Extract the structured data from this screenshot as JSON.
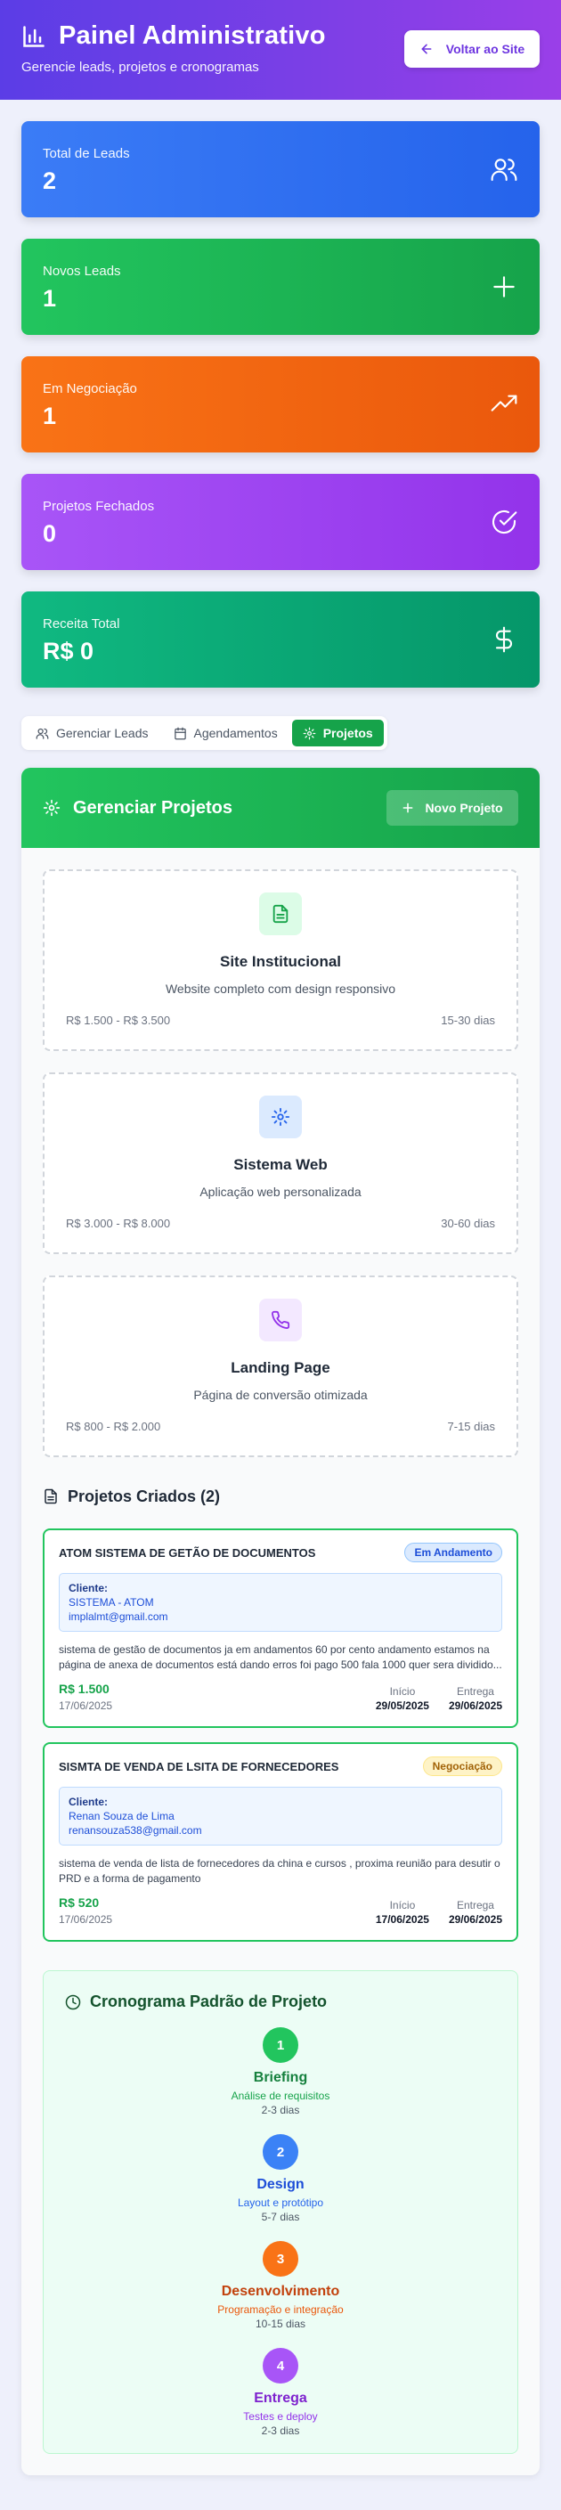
{
  "header": {
    "title": "Painel Administrativo",
    "subtitle": "Gerencie leads, projetos e cronogramas",
    "back_label": "Voltar ao Site"
  },
  "stats": [
    {
      "label": "Total de Leads",
      "value": "2",
      "icon": "users-icon",
      "color": "#2563eb"
    },
    {
      "label": "Novos Leads",
      "value": "1",
      "icon": "plus-icon",
      "color": "#16a34a"
    },
    {
      "label": "Em Negociação",
      "value": "1",
      "icon": "trending-up-icon",
      "color": "#ea580c"
    },
    {
      "label": "Projetos Fechados",
      "value": "0",
      "icon": "check-circle-icon",
      "color": "#9333ea"
    },
    {
      "label": "Receita Total",
      "value": "R$ 0",
      "icon": "dollar-icon",
      "color": "#059669"
    }
  ],
  "tabs": [
    {
      "label": "Gerenciar Leads",
      "icon": "users-icon",
      "active": false
    },
    {
      "label": "Agendamentos",
      "icon": "calendar-icon",
      "active": false
    },
    {
      "label": "Projetos",
      "icon": "gear-icon",
      "active": true
    }
  ],
  "projects_panel": {
    "title": "Gerenciar Projetos",
    "new_label": "Novo Projeto",
    "templates": [
      {
        "name": "Site Institucional",
        "desc": "Website completo com design responsivo",
        "price": "R$ 1.500 - R$ 3.500",
        "time": "15-30 dias",
        "icon": "file-icon"
      },
      {
        "name": "Sistema Web",
        "desc": "Aplicação web personalizada",
        "price": "R$ 3.000 - R$ 8.000",
        "time": "30-60 dias",
        "icon": "gear-icon"
      },
      {
        "name": "Landing Page",
        "desc": "Página de conversão otimizada",
        "price": "R$ 800 - R$ 2.000",
        "time": "7-15 dias",
        "icon": "phone-icon"
      }
    ],
    "created_title": "Projetos Criados (2)",
    "client_label": "Cliente:",
    "start_label": "Início",
    "delivery_label": "Entrega",
    "created": [
      {
        "name": "ATOM SISTEMA DE GETÃO DE DOCUMENTOS",
        "status": "Em Andamento",
        "client_name": "SISTEMA - ATOM",
        "client_email": "implalmt@gmail.com",
        "desc": "sistema de gestão de documentos ja em andamentos 60 por cento andamento estamos na página de anexa de documentos está dando erros foi pago 500 fala 1000 quer sera dividido...",
        "price": "R$ 1.500",
        "created_at": "17/06/2025",
        "start": "29/05/2025",
        "delivery": "29/06/2025"
      },
      {
        "name": "SISMTA DE VENDA DE LSITA DE FORNECEDORES",
        "status": "Negociação",
        "client_name": "Renan Souza de Lima",
        "client_email": "renansouza538@gmail.com",
        "desc": "sistema de venda de lista de fornecedores da china e cursos , proxima reunião para desutir o PRD e a forma de pagamento",
        "price": "R$ 520",
        "created_at": "17/06/2025",
        "start": "17/06/2025",
        "delivery": "29/06/2025"
      }
    ]
  },
  "timeline": {
    "title": "Cronograma Padrão de Projeto",
    "steps": [
      {
        "num": "1",
        "name": "Briefing",
        "desc": "Análise de requisitos",
        "time": "2-3 dias",
        "color": "#22c55e"
      },
      {
        "num": "2",
        "name": "Design",
        "desc": "Layout e protótipo",
        "time": "5-7 dias",
        "color": "#3b82f6"
      },
      {
        "num": "3",
        "name": "Desenvolvimento",
        "desc": "Programação e integração",
        "time": "10-15 dias",
        "color": "#f97316"
      },
      {
        "num": "4",
        "name": "Entrega",
        "desc": "Testes e deploy",
        "time": "2-3 dias",
        "color": "#a855f7"
      }
    ]
  }
}
